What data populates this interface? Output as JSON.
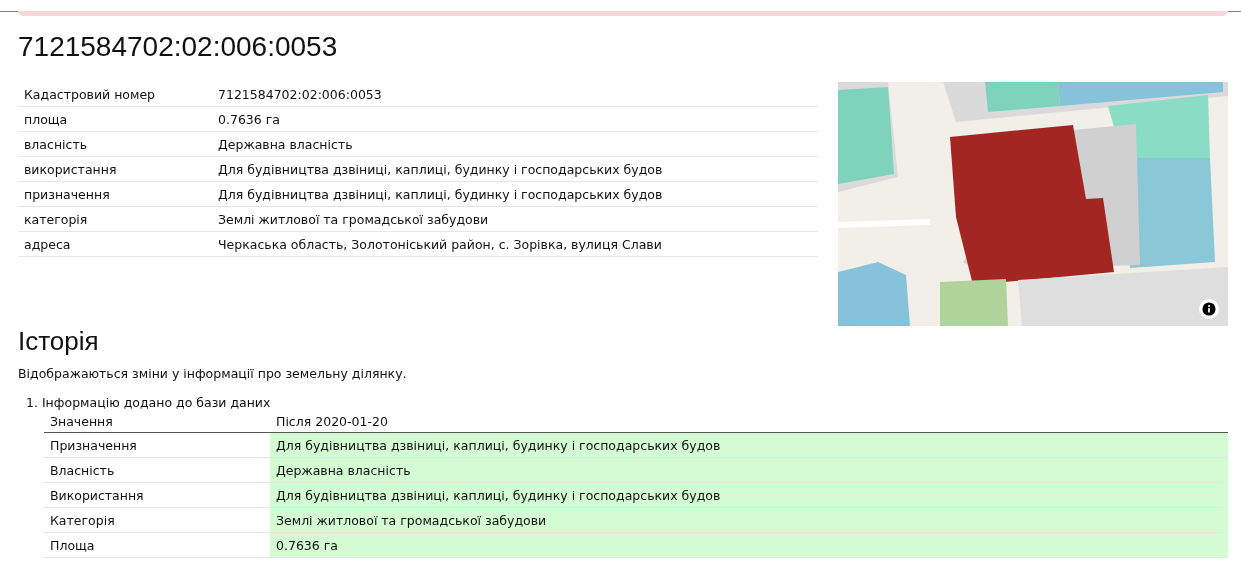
{
  "title": "7121584702:02:006:0053",
  "properties": [
    {
      "label": "Кадастровий номер",
      "value": "7121584702:02:006:0053"
    },
    {
      "label": "площа",
      "value": "0.7636 га"
    },
    {
      "label": "власність",
      "value": "Державна власність"
    },
    {
      "label": "використання",
      "value": "Для будівництва дзвіниці, каплиці, будинку і господарських будов"
    },
    {
      "label": "призначення",
      "value": "Для будівництва дзвіниці, каплиці, будинку і господарських будов"
    },
    {
      "label": "категорія",
      "value": "Землі житлової та громадської забудови"
    },
    {
      "label": "адреса",
      "value": "Черкаська область, Золотоніський район, с. Зорівка, вулиця Слави"
    }
  ],
  "history": {
    "heading": "Історія",
    "description": "Відображаються зміни у інформації про земельну ділянку.",
    "entries": [
      {
        "marker": "1.",
        "title": "Інформацію додано до бази даних",
        "columns": [
          "Значення",
          "Після 2020-01-20"
        ],
        "rows": [
          {
            "field": "Призначення",
            "value": "Для будівництва дзвіниці, каплиці, будинку і господарських будов",
            "changed": true
          },
          {
            "field": "Власність",
            "value": "Державна власність",
            "changed": true
          },
          {
            "field": "Використання",
            "value": "Для будівництва дзвіниці, каплиці, будинку і господарських будов",
            "changed": true
          },
          {
            "field": "Категорія",
            "value": "Землі житлової та громадської забудови",
            "changed": true
          },
          {
            "field": "Площа",
            "value": "0.7636 га",
            "changed": true
          }
        ]
      }
    ]
  }
}
